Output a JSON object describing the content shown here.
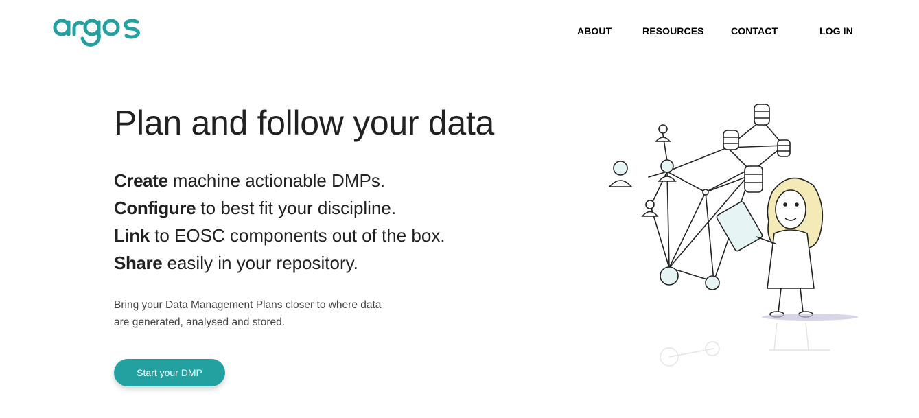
{
  "brand": {
    "logo_text": "argos",
    "accent_color": "#23a1a0"
  },
  "nav": {
    "items": [
      "ABOUT",
      "RESOURCES",
      "CONTACT",
      "LOG IN"
    ]
  },
  "hero": {
    "title": "Plan and follow your data",
    "features": [
      {
        "bold": "Create",
        "rest": "machine actionable DMPs."
      },
      {
        "bold": "Configure",
        "rest": "to best fit your discipline."
      },
      {
        "bold": "Link",
        "rest": "to EOSC components out of the box."
      },
      {
        "bold": "Share",
        "rest": "easily in your repository."
      }
    ],
    "subtext": "Bring your Data Management Plans closer to where data are generated, analysed and stored.",
    "cta_label": "Start your DMP"
  },
  "illustration": {
    "icon": "scientist-network-illustration"
  }
}
